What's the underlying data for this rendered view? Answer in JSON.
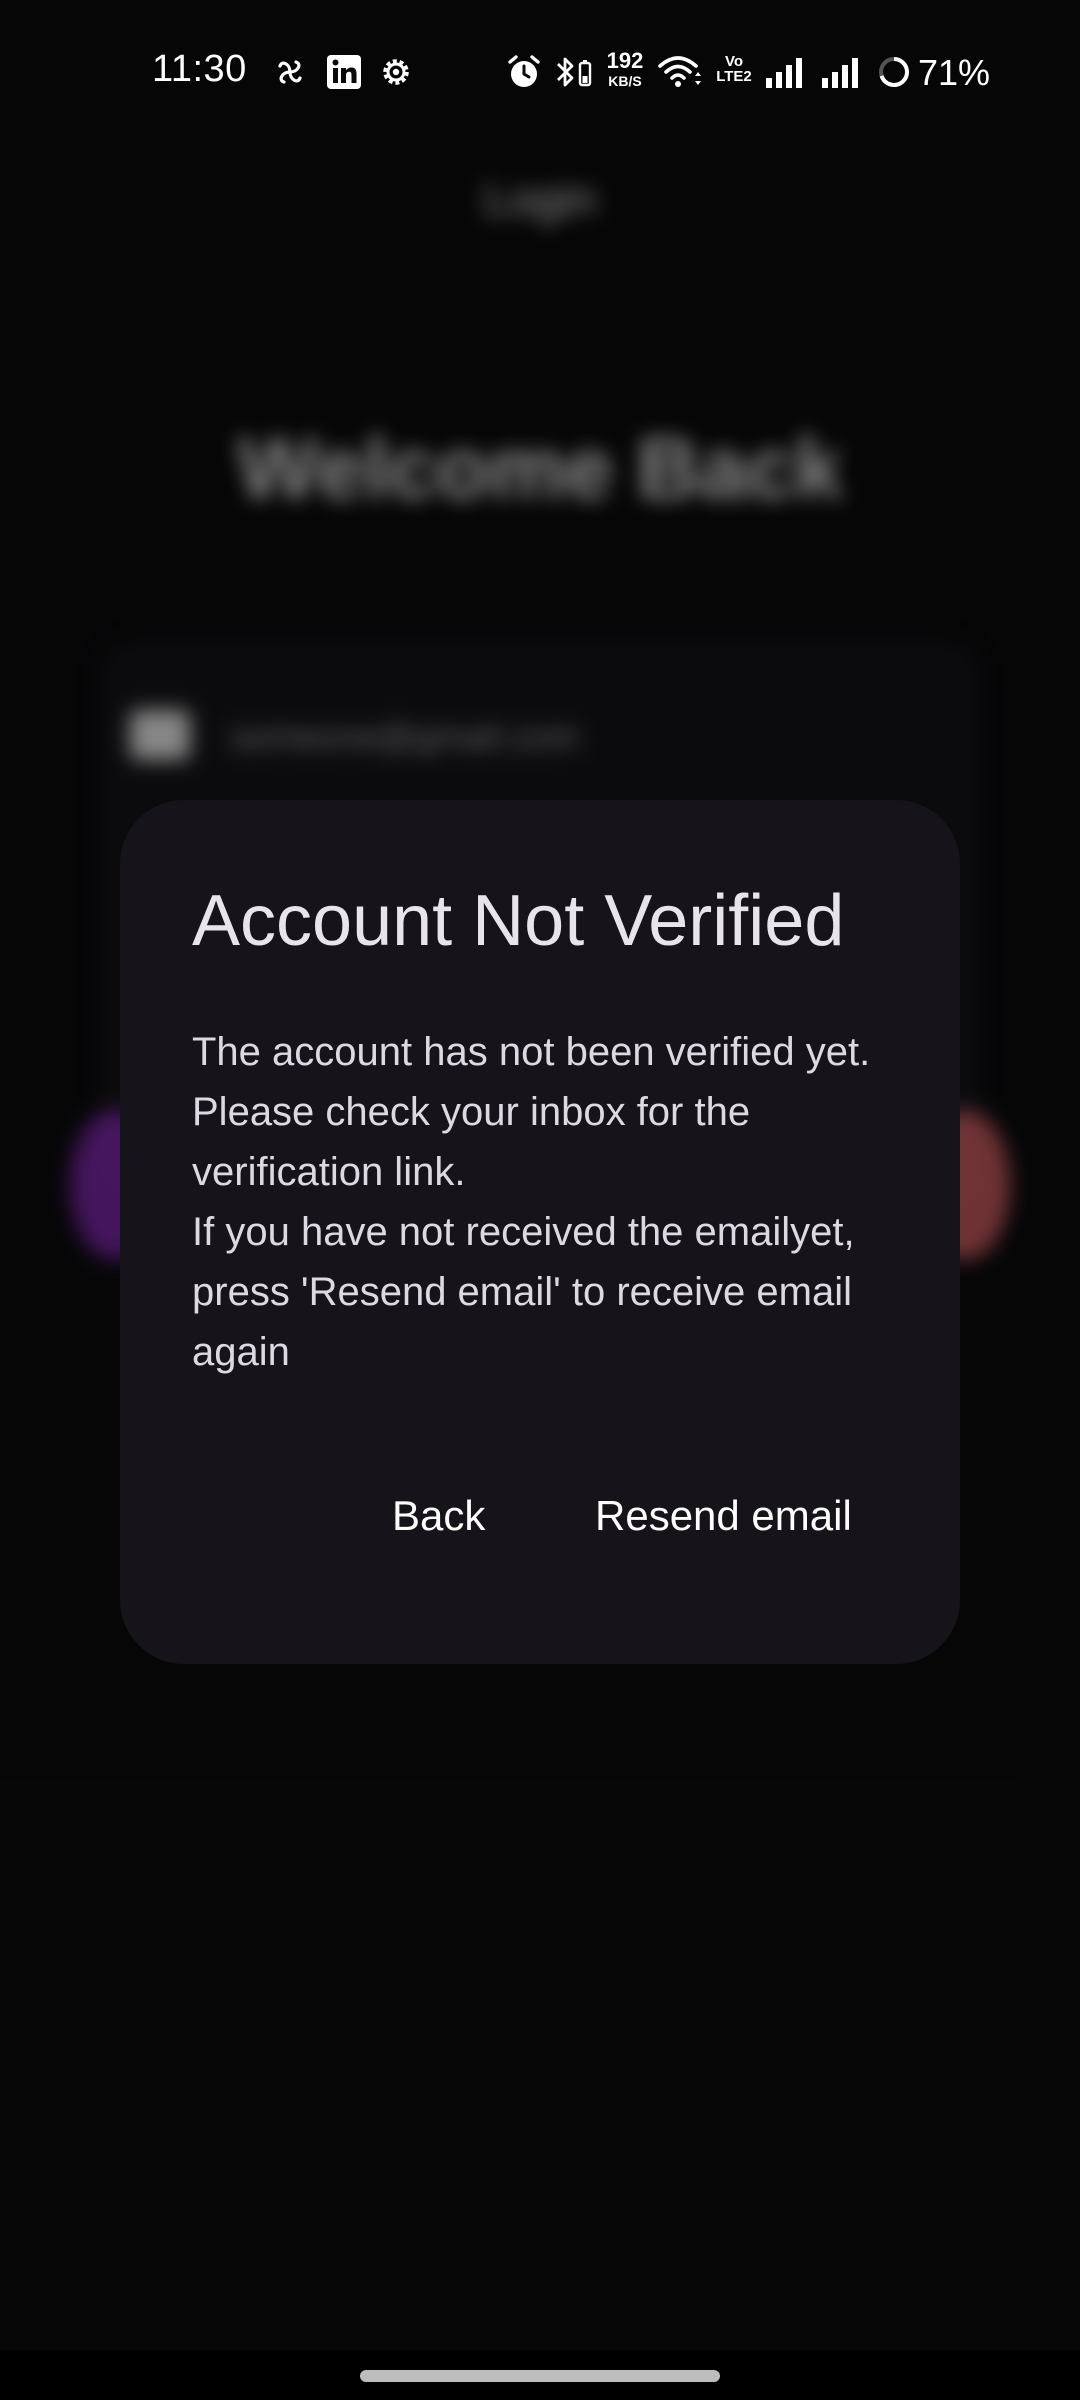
{
  "status_bar": {
    "time": "11:30",
    "net_speed_value": "192",
    "net_speed_unit": "KB/S",
    "volte_top": "Vo",
    "volte_bottom": "LTE2",
    "battery_percent": "71%",
    "icons": [
      "pinwheel-icon",
      "linkedin-icon",
      "settings-gear-icon",
      "alarm-icon",
      "bluetooth-battery-icon",
      "wifi-icon",
      "signal-icon",
      "signal-icon",
      "battery-ring-icon"
    ]
  },
  "login_page": {
    "app_title": "Login",
    "heading": "Welcome Back",
    "email_value": "someone@gmail.com"
  },
  "dialog": {
    "title": "Account Not Verified",
    "message_line1": "The account has not been verified yet. Please check your inbox for the verification link.",
    "message_line2": "If you have not received the emailyet, press 'Resend email' to receive email again",
    "back_label": "Back",
    "resend_label": "Resend email"
  },
  "colors": {
    "background": "#0a0a0c",
    "dialog_surface": "#16141a",
    "text_primary": "#e8e4ec",
    "accent_glow_left": "#8a2ab8",
    "accent_glow_right": "#e0656a"
  }
}
